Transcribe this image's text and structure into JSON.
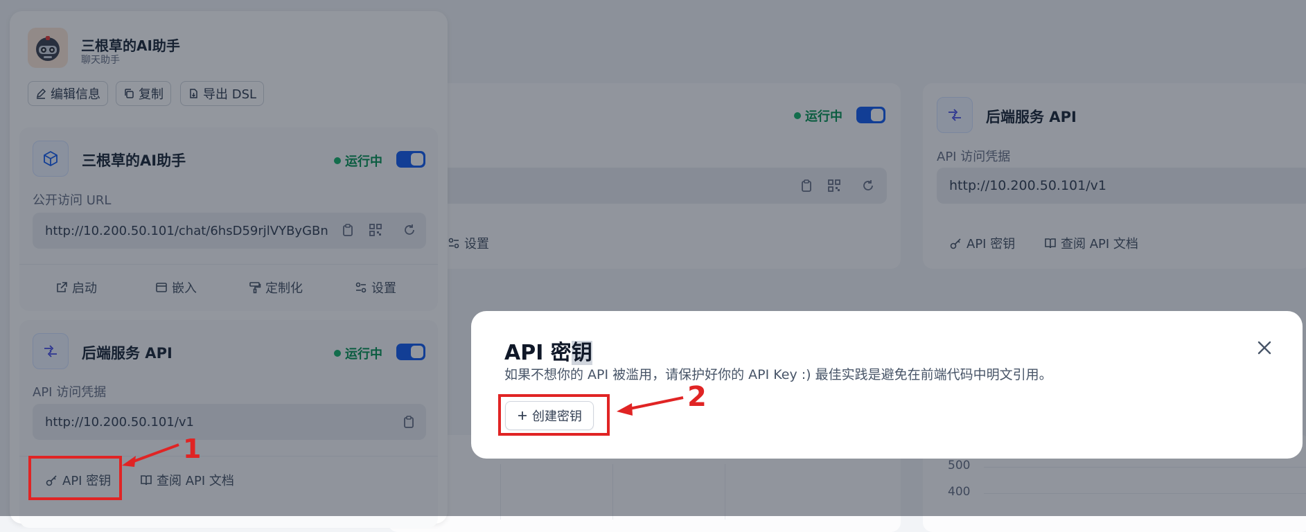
{
  "sidebar": {
    "app_name": "三根草的AI助手",
    "app_subtitle": "聊天助手",
    "buttons": [
      {
        "label": "编辑信息",
        "icon": "pen-icon"
      },
      {
        "label": "复制",
        "icon": "copy-icon"
      },
      {
        "label": "导出 DSL",
        "icon": "export-icon"
      }
    ],
    "webapp_card": {
      "title": "三根草的AI助手",
      "status": "运行中",
      "url_label": "公开访问 URL",
      "url": "http://10.200.50.101/chat/6hsD59rjlVYByGBn",
      "actions": [
        "启动",
        "嵌入",
        "定制化",
        "设置"
      ]
    },
    "api_card": {
      "title": "后端服务 API",
      "status": "运行中",
      "url_label": "API 访问凭据",
      "url": "http://10.200.50.101/v1",
      "actions": [
        "API 密钥",
        "查阅 API 文档"
      ]
    }
  },
  "main": {
    "card1": {
      "status": "运行中",
      "settings_label": "设置"
    },
    "card2": {
      "title": "后端服务 API",
      "url_label": "API 访问凭据",
      "url": "http://10.200.50.101/v1",
      "actions": [
        "API 密钥",
        "查阅 API 文档"
      ]
    },
    "chart_ticks": [
      "500",
      "400"
    ]
  },
  "modal": {
    "title_part1": "API 密",
    "title_part2": "钥",
    "description": "如果不想你的 API 被滥用，请保护好你的 API Key :) 最佳实践是避免在前端代码中明文引用。",
    "create_button": "创建密钥"
  },
  "annotations": {
    "step1": "1",
    "step2": "2"
  },
  "colors": {
    "accent": "#155eef",
    "running": "#17b26a",
    "annotation": "#e02424"
  }
}
